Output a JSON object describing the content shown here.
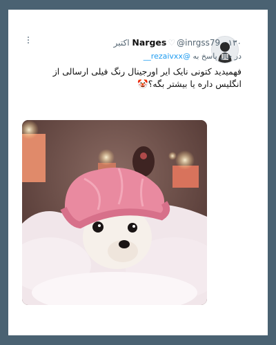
{
  "tweet": {
    "author_name": "Narges",
    "badge_icon": "white-heart-icon",
    "author_handle": "@inrgss79",
    "separator": "·",
    "date": "۱۳۰ اکتبر",
    "more_icon": "more-vertical-icon",
    "reply_prefix": "در حال پاسخ به",
    "reply_to": "@rezaivxx__",
    "text_line1": "فهمیدید کتونی نایک ایر اورجینال رنگ فیلی ارسالی از",
    "text_line2": "انگلیس داره یا بیشتر بگه؟🤡",
    "media_subject": "chihuahua-in-pink-shower-cap-bubble-bath",
    "colors": {
      "mention": "#1d9bf0",
      "meta": "#536471",
      "frame": "#4a6272"
    }
  }
}
